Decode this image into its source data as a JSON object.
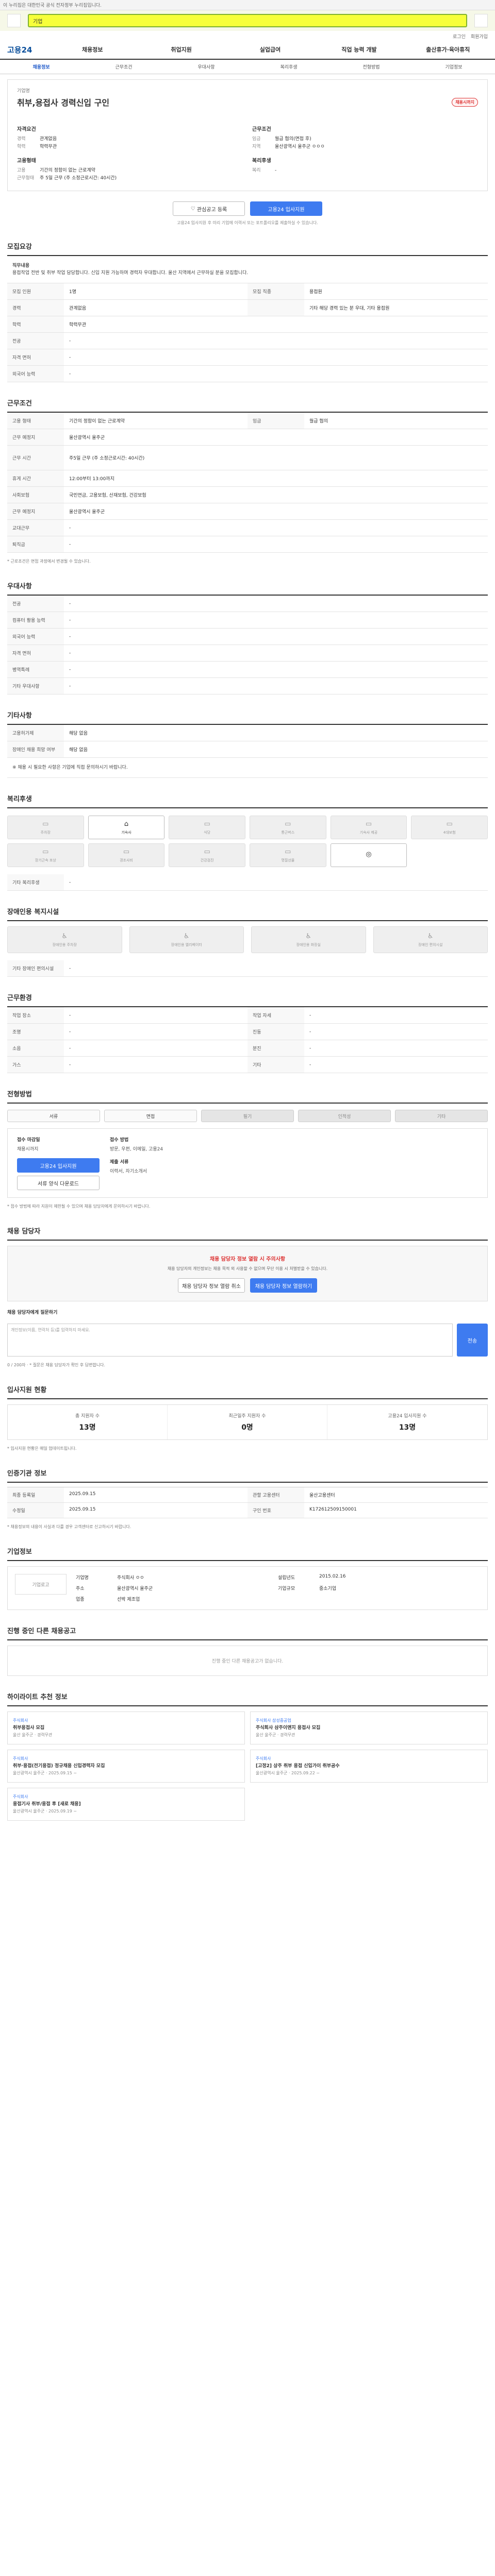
{
  "top": {
    "notice": "이 누리집은 대한민국 공식 전자정부 누리집입니다."
  },
  "brand": {
    "search_value": "기업"
  },
  "util": {
    "login": "로그인",
    "join": "회원가입"
  },
  "gnb": {
    "logo": "고용24",
    "menu": [
      "채용정보",
      "취업지원",
      "실업급여",
      "직업 능력 개발",
      "출산휴가·육아휴직"
    ]
  },
  "tabs": [
    "채용정보",
    "근무조건",
    "우대사항",
    "복리후생",
    "전형방법",
    "기업정보"
  ],
  "job": {
    "sub": "기업명",
    "title": "취부,용접사 경력신입 구인",
    "badge": "채용시까지",
    "left_group": "자격요건",
    "right_group": "근무조건",
    "items_left": [
      [
        "경력",
        "관계없음"
      ],
      [
        "학력",
        "학력무관"
      ]
    ],
    "items_right": [
      [
        "임금",
        "월급 협의(면접 후)"
      ],
      [
        "지역",
        "울산광역시 울주군 ㅇㅇㅇ"
      ]
    ],
    "left_group2": "고용형태",
    "items_left2": [
      [
        "고용",
        "기간의 정함이 없는 근로계약"
      ],
      [
        "근무형태",
        "주 5일 근무 (주 소정근로시간: 40시간)"
      ]
    ],
    "right_group2": "복리후생",
    "items_right2": [
      [
        "복리",
        "-"
      ]
    ],
    "btn_save": "관심공고 등록",
    "btn_apply": "고용24 입사지원",
    "note": "고용24 입사지원 후 미리 기업에 이력서 또는 포트폴리오를 제출하실 수 있습니다."
  },
  "recruit": {
    "title": "모집요강",
    "desc_head": "직무내용",
    "desc": "용접작업 전반 및 취부 작업 담당합니다. 신입 지원 가능하며 경력자 우대합니다. 울산 지역에서 근무하실 분을 모집합니다.",
    "rows": [
      [
        "모집 인원",
        "1명"
      ],
      [
        "경력",
        "관계없음"
      ],
      [
        "학력",
        "학력무관"
      ],
      [
        "전공",
        "-"
      ],
      [
        "자격 면허",
        "-"
      ],
      [
        "외국어 능력",
        "-"
      ]
    ],
    "right_rows": [
      [
        "모집 직종",
        "용접원"
      ],
      [
        "",
        "-"
      ],
      [
        "",
        "기타 해당 경력 있는 분 우대, 기타 용접원"
      ],
      [
        "",
        "-"
      ]
    ]
  },
  "cond": {
    "title": "근무조건",
    "rows": [
      [
        "고용 형태",
        "기간의 정함이 없는 근로계약"
      ],
      [
        "근무 예정지",
        "울산광역시 울주군"
      ],
      [
        "근무 시간",
        "주5일 근무 (주 소정근로시간: 40시간)"
      ],
      [
        "휴게 시간",
        "12:00부터 13:00까지"
      ],
      [
        "사회보험",
        "국민연금, 고용보험, 산재보험, 건강보험"
      ],
      [
        "근무 예정지",
        "울산광역시 울주군"
      ],
      [
        "교대근무",
        "-"
      ],
      [
        "퇴직금",
        "-"
      ]
    ],
    "wage": "월급 협의",
    "foot": "* 근로조건은 면접 과정에서 변경될 수 있습니다."
  },
  "prefer": {
    "title": "우대사항",
    "rows": [
      [
        "전공",
        "-"
      ],
      [
        "컴퓨터 활용 능력",
        "-"
      ],
      [
        "외국어 능력",
        "-"
      ],
      [
        "자격 면허",
        "-"
      ],
      [
        "병역특례",
        "-"
      ],
      [
        "기타 우대사항",
        "-"
      ]
    ]
  },
  "etc": {
    "title": "기타사항",
    "rows": [
      [
        "고용허가제",
        "해당 없음"
      ],
      [
        "장애인 채용 희망 여부",
        "해당 없음"
      ]
    ],
    "desc": "※ 채용 시 필요한 사항은 기업에 직접 문의하시기 바랍니다."
  },
  "welfare": {
    "title": "복리후생",
    "items": [
      "주차장",
      "기숙사",
      "식당",
      "통근버스",
      "기숙사 제공",
      "4대보험",
      "장기근속 포상",
      "경조사비",
      "건강검진",
      "명절선물",
      "",
      ""
    ],
    "active": [
      1,
      11
    ],
    "etc_label": "기타 복리후생"
  },
  "disabled": {
    "title": "장애인용 복지시설",
    "items": [
      "장애인용 주차장",
      "장애인용 엘리베이터",
      "장애인용 화장실",
      "장애인 편의시설"
    ],
    "etc_label": "기타 장애인 편의시설"
  },
  "work": {
    "title": "근무환경",
    "rows": [
      [
        "작업 장소",
        "-"
      ],
      [
        "조명",
        "-"
      ],
      [
        "소음",
        "-"
      ],
      [
        "가스",
        "-"
      ]
    ],
    "right": [
      [
        "작업 자세",
        "-"
      ],
      [
        "진동",
        "-"
      ],
      [
        "분진",
        "-"
      ],
      [
        "기타",
        "-"
      ]
    ]
  },
  "method": {
    "title": "전형방법",
    "items": [
      "서류",
      "면접",
      "필기",
      "인적성",
      "기타"
    ],
    "dim": [
      2,
      3,
      4
    ],
    "apply_label": "접수 마감일",
    "apply_value": "채용시까지",
    "method_label": "접수 방법",
    "method_value": "방문, 우편, 이메일, 고용24",
    "doc_label": "제출 서류",
    "doc_value": "이력서, 자기소개서",
    "btn_apply": "고용24 입사지원",
    "btn_doc": "서류 양식 다운로드",
    "bullets": "* 접수 방법에 따라 지원이 제한될 수 있으며 채용 담당자에게 문의하시기 바랍니다."
  },
  "contact": {
    "title": "채용 담당자",
    "warn": "채용 담당자 정보 열람 시 주의사항",
    "p": "채용 담당자의 개인정보는 채용 목적 외 사용할 수 없으며 무단 이용 시 처벌받을 수 있습니다.",
    "btn1": "채용 담당자 정보 열람 취소",
    "btn2": "채용 담당자 정보 열람하기",
    "qa_label": "채용 담당자에게 질문하기",
    "qa_placeholder": "개인정보(이름, 연락처 등)를 입력하지 마세요.",
    "send": "전송",
    "qa_count": "0 / 200자",
    "note": "* 질문은 채용 담당자가 확인 후 답변합니다."
  },
  "status": {
    "title": "입사지원 현황",
    "items": [
      [
        "총 지원자 수",
        "13명"
      ],
      [
        "최근일주 지원자 수",
        "0명"
      ],
      [
        "고용24 입사지원 수",
        "13명"
      ]
    ],
    "note": "* 입사지원 현황은 매일 업데이트됩니다."
  },
  "info": {
    "title": "인증기관 정보",
    "rows": [
      [
        "최종 등록일",
        "2025.09.15"
      ],
      [
        "수정일",
        "2025.09.15"
      ],
      [
        "관할 고용센터",
        "울산고용센터"
      ],
      [
        "구인 번호",
        "K172612509150001"
      ]
    ],
    "note": "* 채용정보의 내용이 사실과 다를 경우 고객센터로 신고하시기 바랍니다."
  },
  "company": {
    "title": "기업정보",
    "logo": "기업로고",
    "name_label": "기업명",
    "name": "주식회사 ㅇㅇ",
    "addr_label": "주소",
    "addr": "울산광역시 울주군",
    "type_label": "업종",
    "type": "선박 제조업",
    "size_label": "기업규모",
    "size": "중소기업",
    "year_label": "설립년도",
    "year": "2015.02.16"
  },
  "ended": {
    "title": "진행 중인 다른 채용공고",
    "empty": "진행 중인 다른 채용공고가 없습니다."
  },
  "recommend": {
    "title": "하이라이트 추천 정보",
    "cards": [
      {
        "c": "주식회사",
        "ti": "취부용접사 모집",
        "m": "울산 울주군 · 경력무관"
      },
      {
        "c": "주식회사 삼성중공업",
        "ti": "주식회사 삼주이앤지 용접사 모집",
        "m": "울산 울주군 · 경력무관"
      },
      {
        "c": "주식회사",
        "ti": "취부·용접(전기용접) 정규채용 신입경력자 모집",
        "m": "울산광역시 울주군 · 2025.09.15 ~"
      },
      {
        "c": "주식회사",
        "ti": "[고정2] 상주 취부 용접 신입가이 취부공수",
        "m": "울산광역시 울주군 · 2025.09.22 ~"
      },
      {
        "c": "주식회사",
        "ti": "용접기사 취부/용접 후 [새로 채용]",
        "m": "울산광역시 울주군 · 2025.09.19 ~"
      }
    ]
  }
}
